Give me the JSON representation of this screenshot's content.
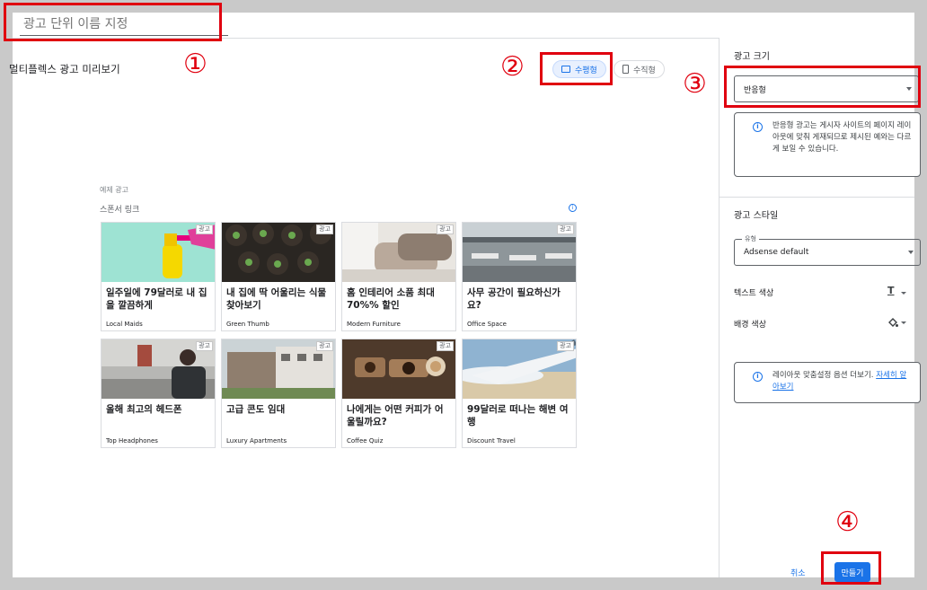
{
  "dialog": {
    "ad_unit_name_placeholder": "광고 단위 이름 지정",
    "preview_title": "멀티플렉스 광고 미리보기",
    "orientation": {
      "horizontal_label": "수평형",
      "vertical_label": "수직형",
      "selected": "수평형"
    },
    "preview": {
      "sample_label": "예제 광고",
      "sponsored_label": "스폰서 링크",
      "ad_badge": "광고",
      "ads": [
        {
          "headline": "일주일에 79달러로 내 집을 깔끔하게",
          "source": "Local Maids"
        },
        {
          "headline": "내 집에 딱 어울리는 식물 찾아보기",
          "source": "Green Thumb"
        },
        {
          "headline": "홈 인테리어 소품 최대 70%% 할인",
          "source": "Modern Furniture"
        },
        {
          "headline": "사무 공간이 필요하신가요?",
          "source": "Office Space"
        },
        {
          "headline": "올해 최고의 헤드폰",
          "source": "Top Headphones"
        },
        {
          "headline": "고급 콘도 임대",
          "source": "Luxury Apartments"
        },
        {
          "headline": "나에게는 어떤 커피가 어울릴까요?",
          "source": "Coffee Quiz"
        },
        {
          "headline": "99달러로 떠나는 해변 여행",
          "source": "Discount Travel"
        }
      ]
    },
    "settings": {
      "ad_size_label": "광고 크기",
      "ad_size_value": "반응형",
      "ad_size_info": "반응형 광고는 게시자 사이트의 페이지 레이아웃에 맞춰 게재되므로 제시된 예와는 다르게 보일 수 있습니다.",
      "ad_style_label": "광고 스타일",
      "style_select_label": "유형",
      "style_select_value": "Adsense default",
      "text_color_label": "텍스트 색상",
      "bg_color_label": "배경 색상",
      "layout_info_text": "레이아웃 맞춤설정 옵션 더보기.",
      "layout_info_link": "자세히 알아보기"
    },
    "footer": {
      "cancel_label": "취소",
      "create_label": "만들기"
    }
  },
  "annotations": [
    "①",
    "②",
    "③",
    "④"
  ],
  "colors": {
    "accent": "#1a73e8",
    "annotation_red": "#e0000f"
  }
}
